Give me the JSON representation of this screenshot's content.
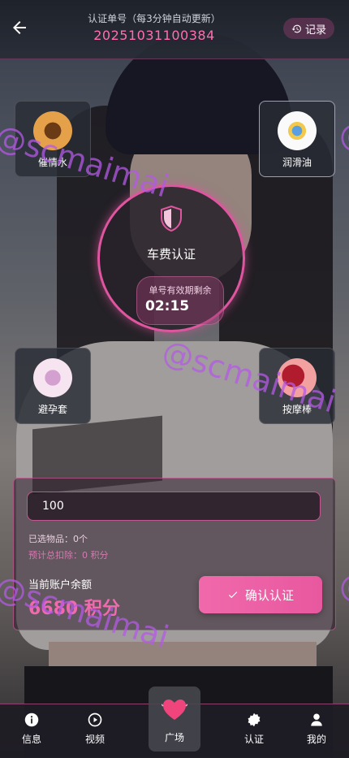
{
  "header": {
    "label": "认证单号（每3分钟自动更新）",
    "order_no": "20251031100384",
    "record_label": "记录"
  },
  "items": [
    {
      "name": "催情水",
      "icon": "spray-bottle-icon"
    },
    {
      "name": "润滑油",
      "icon": "lubricant-icon"
    },
    {
      "name": "避孕套",
      "icon": "condom-icon"
    },
    {
      "name": "按摩棒",
      "icon": "massager-icon"
    }
  ],
  "center": {
    "title": "车费认证",
    "countdown_label": "单号有效期剩余",
    "countdown_value": "02:15"
  },
  "form": {
    "quantity_value": "100",
    "selected_text": "已选物品：0个",
    "deduct_text": "预计总扣除：0 积分",
    "balance_label": "当前账户余额",
    "balance_value": "6680 积分",
    "confirm_label": "确认认证"
  },
  "tabbar": {
    "tabs": [
      {
        "label": "信息",
        "icon": "info-icon"
      },
      {
        "label": "视频",
        "icon": "play-icon"
      },
      {
        "label": "广场",
        "icon": "heart-icon"
      },
      {
        "label": "认证",
        "icon": "badge-icon"
      },
      {
        "label": "我的",
        "icon": "user-icon"
      }
    ]
  },
  "watermark": "@scmaimai",
  "colors": {
    "accent": "#e8589f",
    "order_number": "#ff6fb0",
    "balance": "#f06aad",
    "watermark": "#b45ae6"
  }
}
